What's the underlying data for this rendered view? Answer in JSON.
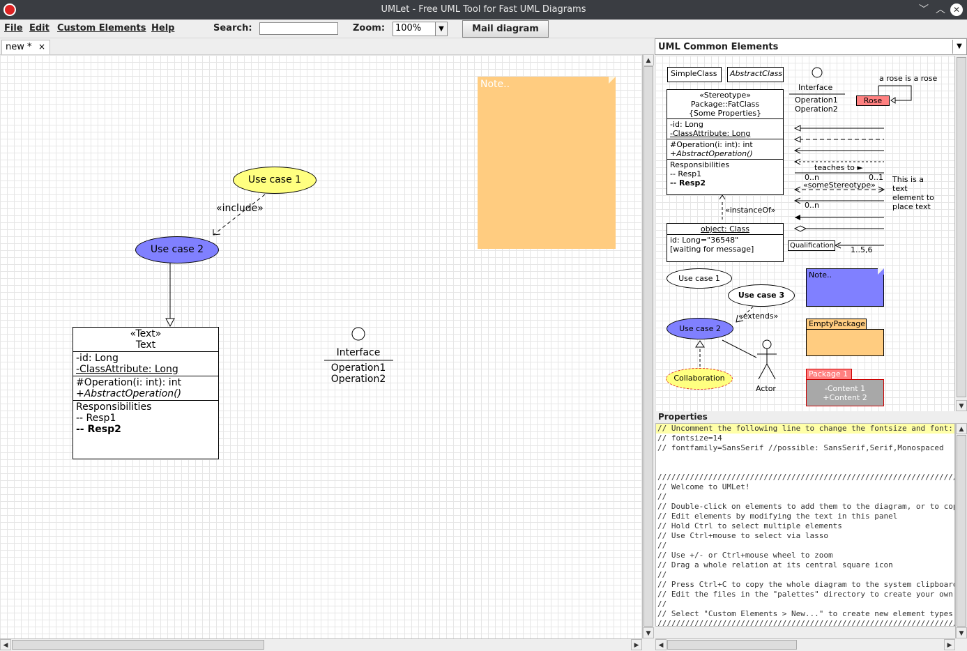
{
  "window": {
    "title": "UMLet - Free UML Tool for Fast UML Diagrams",
    "minimize": "﹀",
    "maximize": "︿",
    "close": "✕"
  },
  "menu": {
    "file": "File",
    "edit": "Edit",
    "custom": "Custom Elements",
    "help": "Help",
    "search_label": "Search:",
    "zoom_label": "Zoom:",
    "zoom_value": "100%",
    "mail": "Mail diagram"
  },
  "tab": {
    "label": "new *",
    "close": "×"
  },
  "diagram": {
    "usecase1": "Use case 1",
    "include": "«include»",
    "usecase2": "Use case 2",
    "note": "Note..",
    "text_class": {
      "stereo": "«Text»",
      "name": "Text",
      "attr1": "-id: Long",
      "attr2": "-ClassAttribute: Long",
      "op1": "#Operation(i: int): int",
      "op2": "+AbstractOperation()",
      "resp": "Responsibilities",
      "resp1": "-- Resp1",
      "resp2": "-- Resp2"
    },
    "interface": {
      "name": "Interface",
      "op1": "Operation1",
      "op2": "Operation2"
    }
  },
  "palette": {
    "title": "UML Common Elements",
    "simple": "SimpleClass",
    "abstract": "AbstractClass",
    "iface_name": "Interface",
    "iface_op1": "Operation1",
    "iface_op2": "Operation2",
    "rose_note": "a rose is a rose",
    "rose": "Rose",
    "fat_stereo": "«Stereotype»",
    "fat_name": "Package::FatClass",
    "fat_props": "{Some Properties}",
    "fat_a1": "-id: Long",
    "fat_a2": "-ClassAttribute: Long",
    "fat_o1": "#Operation(i: int): int",
    "fat_o2": "+AbstractOperation()",
    "fat_r": "Responsibilities",
    "fat_r1": "-- Resp1",
    "fat_r2": "-- Resp2",
    "teaches": "teaches to ►",
    "m1": "0..n",
    "m2": "0..1",
    "somestereo": "«someStereotype»",
    "m3": "0..n",
    "text_el1": "This is a",
    "text_el2": "text",
    "text_el3": "element to",
    "text_el4": "place text",
    "instanceof": "«instanceOf»",
    "obj": "object: Class",
    "obj_a1": "id: Long=\"36548\"",
    "obj_a2": "[waiting for message]",
    "qual": "Qualification",
    "qual_m": "1..5,6",
    "uc1": "Use case 1",
    "uc3": "Use case 3",
    "extends": "«extends»",
    "uc2": "Use case 2",
    "collab": "Collaboration",
    "actor": "Actor",
    "note": "Note..",
    "emptypkg": "EmptyPackage",
    "pkg1": "Package 1",
    "pkg_c1": "-Content 1",
    "pkg_c2": "+Content 2"
  },
  "properties": {
    "label": "Properties",
    "lines": [
      "// Uncomment the following line to change the fontsize and font:",
      "// fontsize=14",
      "// fontfamily=SansSerif //possible: SansSerif,Serif,Monospaced",
      "",
      "",
      "//////////////////////////////////////////////////////////////////////////////////////////////",
      "// Welcome to UMLet!",
      "//",
      "// Double-click on elements to add them to the diagram, or to copy them",
      "// Edit elements by modifying the text in this panel",
      "// Hold Ctrl to select multiple elements",
      "// Use Ctrl+mouse to select via lasso",
      "//",
      "// Use +/- or Ctrl+mouse wheel to zoom",
      "// Drag a whole relation at its central square icon",
      "//",
      "// Press Ctrl+C to copy the whole diagram to the system clipboard",
      "// Edit the files in the \"palettes\" directory to create your own element palettes",
      "//",
      "// Select \"Custom Elements > New...\" to create new element types",
      "//////////////////////////////////////////////////////////////////////////////////////////////"
    ]
  },
  "colors": {
    "yellow": "#ffff80",
    "blue": "#8080ff",
    "note": "#ffcc80",
    "rose": "#ff8080"
  }
}
